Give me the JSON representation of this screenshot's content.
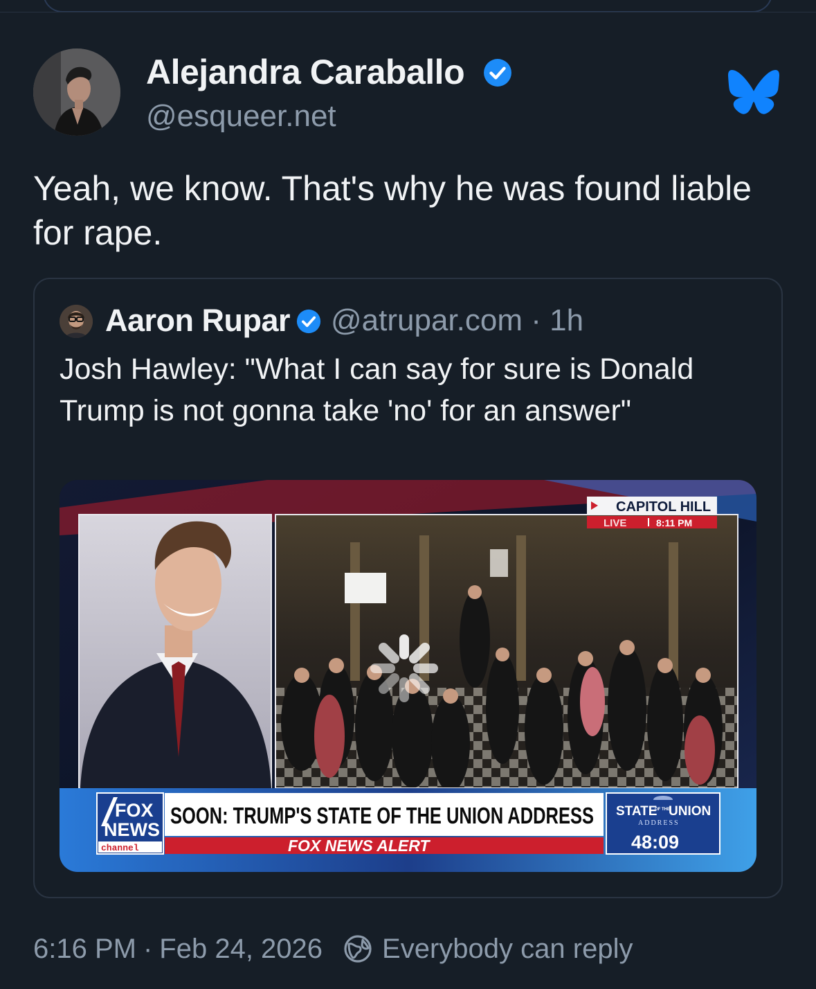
{
  "post": {
    "author_name": "Alejandra Caraballo",
    "author_handle": "@esqueer.net",
    "text": "Yeah, we know. That's why he was found liable for rape.",
    "time": "6:16 PM",
    "separator": "·",
    "date": "Feb 24, 2026",
    "reply_setting": "Everybody can reply"
  },
  "quote": {
    "author_name": "Aaron Rupar",
    "handle_and_time": "@atrupar.com · 1h",
    "text": "Josh Hawley: \"What I can say for sure is Donald Trump is not gonna take 'no' for an answer\""
  },
  "video": {
    "location_label": "CAPITOL HILL",
    "live_label": "LIVE",
    "live_time": "8:11 PM",
    "network_line1": "FOX",
    "network_line2": "NEWS",
    "network_line3": "channel",
    "headline": "SOON: TRUMP'S STATE OF THE UNION ADDRESS",
    "alert_label": "FOX NEWS ALERT",
    "sotu_line1": "STATE",
    "sotu_of_the": "OF THE",
    "sotu_line2": "UNION",
    "sotu_address": "ADDRESS",
    "countdown": "48:09"
  },
  "colors": {
    "background": "#161e27",
    "text_primary": "#f1f3f5",
    "text_secondary": "#8d9bab",
    "verified_blue": "#1d8cf8",
    "bluesky_blue": "#1083fe",
    "fox_red": "#cc1f2d",
    "fox_blue": "#1a3f8f"
  },
  "icons": {
    "verified": "verified-badge-icon",
    "brand": "bluesky-butterfly-icon",
    "reply_setting": "globe-icon",
    "loading": "loading-spinner-icon"
  }
}
